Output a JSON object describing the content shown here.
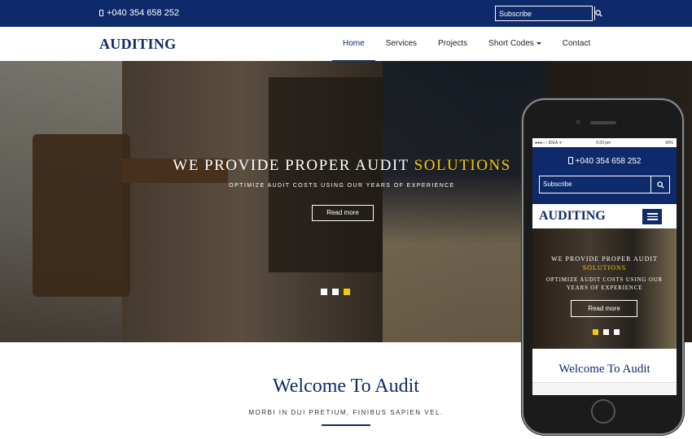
{
  "topbar": {
    "phone": "+040 354 658 252",
    "subscribe_placeholder": "Subscribe",
    "search_icon": "search-icon"
  },
  "nav": {
    "logo": "AUDITING",
    "items": [
      {
        "label": "Home",
        "active": true
      },
      {
        "label": "Services"
      },
      {
        "label": "Projects"
      },
      {
        "label": "Short Codes",
        "dropdown": true
      },
      {
        "label": "Contact"
      }
    ]
  },
  "hero": {
    "title_main": "WE PROVIDE PROPER AUDIT ",
    "title_accent": "SOLUTIONS",
    "subtitle": "OPTIMIZE AUDIT COSTS USING OUR YEARS OF EXPERIENCE",
    "button": "Read more",
    "slides": 3,
    "active_slide": 3
  },
  "welcome": {
    "title": "Welcome To Audit",
    "subtitle": "MORBI IN DUI PRETIUM, FINIBUS SAPIEN VEL."
  },
  "phone_mockup": {
    "status_carrier": "●●●○○ IDEA ᯤ",
    "status_time": "9:20 pm",
    "status_battery": "90%",
    "phone": "+040 354 658 252",
    "subscribe": "Subscribe",
    "logo": "AUDITING",
    "hero_title_main": "WE PROVIDE PROPER AUDIT",
    "hero_title_accent": "SOLUTIONS",
    "hero_subtitle": "OPTIMIZE AUDIT COSTS USING OUR YEARS OF EXPERIENCE",
    "hero_button": "Read more",
    "active_slide": 1,
    "welcome": "Welcome To Audit"
  },
  "colors": {
    "brand": "#0e2a6b",
    "accent": "#f6c900"
  }
}
